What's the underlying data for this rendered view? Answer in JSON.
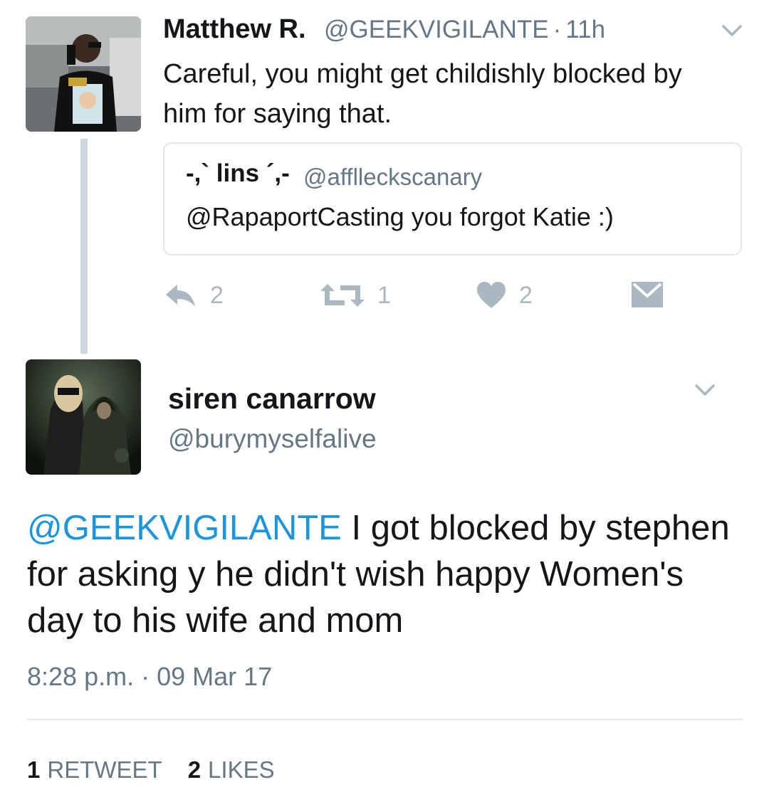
{
  "reply_tweet": {
    "display_name": "Matthew R.",
    "handle": "@GEEKVIGILANTE",
    "separator": "·",
    "age": "11h",
    "text": "Careful, you might get childishly blocked by him for saying that.",
    "quoted": {
      "display_name": "-,` lins ´,-",
      "handle": "@afflleckscanary",
      "text": "@RapaportCasting you forgot Katie :)"
    },
    "actions": {
      "reply_count": "2",
      "retweet_count": "1",
      "like_count": "2"
    }
  },
  "main_tweet": {
    "display_name": "siren canarrow",
    "handle": "@burymyselfalive",
    "mention": "@GEEKVIGILANTE",
    "text": " I got blocked by stephen for asking y he didn't wish happy Women's day to his wife and mom",
    "time": "8:28 p.m.",
    "separator": "·",
    "date": "09 Mar 17",
    "retweets_count": "1",
    "retweets_label": "RETWEET",
    "likes_count": "2",
    "likes_label": "LIKES"
  },
  "colors": {
    "link": "#1b95e0",
    "secondary_text": "#657786",
    "action_icon": "#aab8c2",
    "thread_line": "#ccd6dd"
  },
  "icons": [
    "chevron-down-icon",
    "reply-icon",
    "retweet-icon",
    "heart-icon",
    "direct-message-icon"
  ]
}
